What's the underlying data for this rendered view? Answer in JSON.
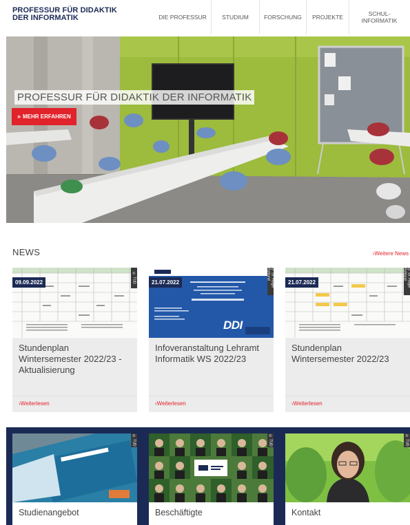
{
  "header": {
    "logo_line1": "PROFESSUR FÜR DIDAKTIK",
    "logo_line2": "DER INFORMATIK",
    "nav": [
      {
        "label": "DIE PROFESSUR"
      },
      {
        "label": "STUDIUM"
      },
      {
        "label": "FORSCHUNG"
      },
      {
        "label": "PROJEKTE"
      },
      {
        "label_line1": "SCHUL-",
        "label_line2": "INFORMATIK"
      }
    ]
  },
  "hero": {
    "title": "PROFESSUR FÜR DIDAKTIK DER INFORMATIK",
    "button_label": "MEHR ERFAHREN",
    "button_icon": "double-chevron-down-icon"
  },
  "news": {
    "heading": "NEWS",
    "more_link": "›Weitere News",
    "items": [
      {
        "date": "09.09.2022",
        "title": "Stundenplan Wintersemester 2022/23 - Aktualisierung",
        "link": "›Weiterlesen",
        "credit": "© TUD"
      },
      {
        "date": "21.07.2022",
        "title": "Infoveranstaltung Lehramt Informatik WS 2022/23",
        "link": "›Weiterlesen",
        "credit": "© Dr. Holger Rohland"
      },
      {
        "date": "21.07.2022",
        "title": "Stundenplan Wintersemester 2022/23",
        "link": "›Weiterlesen",
        "credit": "© Dr. Holger Rohland"
      }
    ],
    "poster_brand": "DDI"
  },
  "tiles": [
    {
      "label": "Studienangebot",
      "credit": "© TUD"
    },
    {
      "label": "Beschäftigte",
      "credit": "© TUD"
    },
    {
      "label": "Kontakt",
      "credit": "© TUD"
    }
  ],
  "colors": {
    "navy": "#1b2a55",
    "accent_red": "#e1232b",
    "card_bg": "#ececec"
  }
}
